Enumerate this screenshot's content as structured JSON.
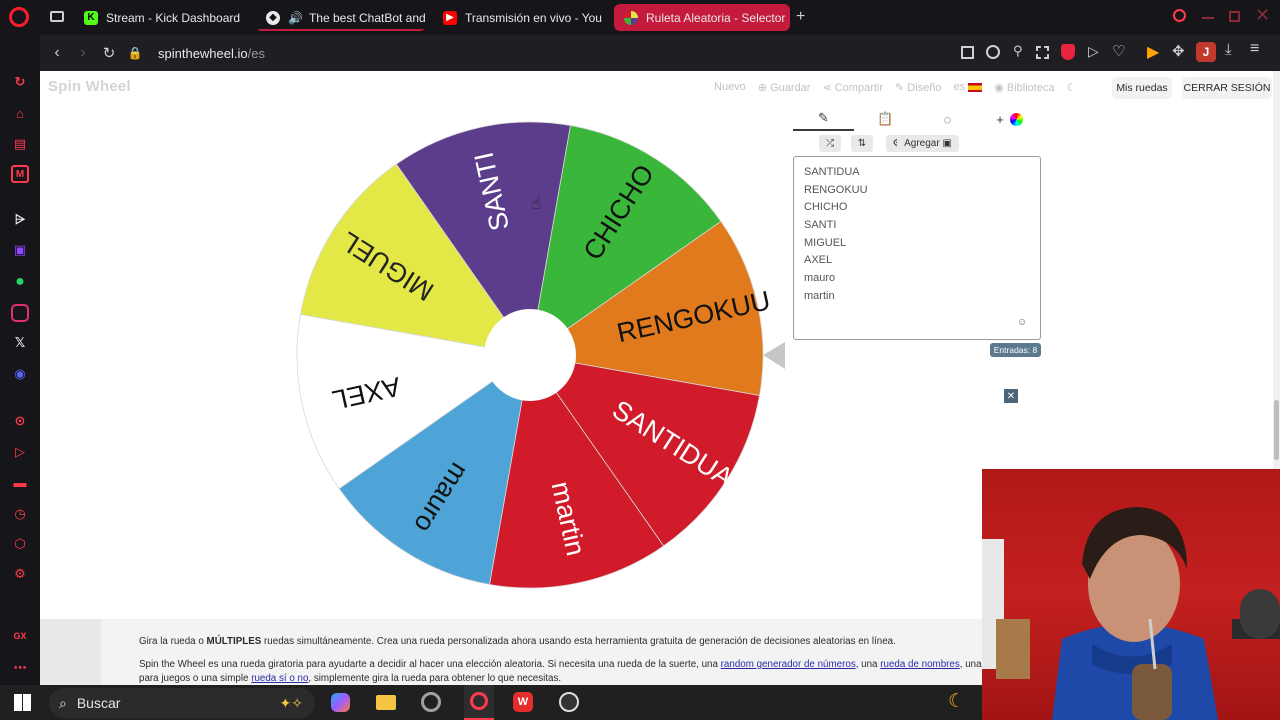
{
  "browser": {
    "tabs": [
      {
        "label": "Stream - Kick Dashboard",
        "icon": "kick-icon",
        "color": "#53fc18"
      },
      {
        "label": "The best ChatBot and",
        "icon": "botrix-icon",
        "color": "#e9e9e9"
      },
      {
        "label": "Transmisión en vivo - You",
        "icon": "youtube-icon",
        "color": "#ff0000"
      },
      {
        "label": "Ruleta Aleatoria - Selector",
        "icon": "spinthewheel-icon",
        "color": "#c41b3c"
      }
    ],
    "url_host": "spinthewheel.io",
    "url_path": "/es",
    "profile_letter": "J"
  },
  "page": {
    "logo": "Spin Wheel",
    "menu": [
      "Nuevo",
      "Guardar",
      "Compartir",
      "Diseño",
      "es",
      "Biblioteca"
    ],
    "my_wheels": "Mis ruedas",
    "logout": "CERRAR SESIÓN"
  },
  "wheel": {
    "segments": [
      {
        "label": "MIGUEL",
        "color": "#e3e847",
        "text_color": "#222222"
      },
      {
        "label": "SANTI",
        "color": "#5b3d8c",
        "text_color": "#ffffff"
      },
      {
        "label": "CHICHO",
        "color": "#3ab73a",
        "text_color": "#111111"
      },
      {
        "label": "RENGOKUU",
        "color": "#e07a1c",
        "text_color": "#111111"
      },
      {
        "label": "SANTIDUA",
        "color": "#d11a2a",
        "text_color": "#ffffff"
      },
      {
        "label": "martin",
        "color": "#d11a2a",
        "text_color": "#ffffff"
      },
      {
        "label": "mauro",
        "color": "#4ea4d6",
        "text_color": "#111111"
      },
      {
        "label": "AXEL",
        "color": "#ffffff",
        "text_color": "#111111"
      }
    ]
  },
  "editor": {
    "add_label": "Agregar",
    "entries": [
      "SANTIDUA",
      "RENGOKUU",
      "CHICHO",
      "SANTI",
      "MIGUEL",
      "AXEL",
      "mauro",
      "martin"
    ],
    "entries_count": "Entradas: 8"
  },
  "footer": {
    "line1_a": "Gira la rueda o ",
    "line1_b": "MÚLTIPLES",
    "line1_c": " ruedas simultáneamente. Crea una rueda personalizada ahora usando esta herramienta gratuita de generación de decisiones aleatorias en línea.",
    "line2_a": "Spin the Wheel es una rueda giratoria para ayudarte a decidir al hacer una elección aleatoria. Si necesita una rueda de la suerte, una ",
    "line2_link1": "random generador de números",
    "line2_b": ", una ",
    "line2_link2": "rueda de nombres",
    "line2_c": ", una g",
    "line3_a": "para juegos o una simple ",
    "line3_link": "rueda sí o no",
    "line3_b": ", simplemente gira la rueda para obtener lo que necesitas."
  },
  "taskbar": {
    "search_label": "Buscar"
  }
}
